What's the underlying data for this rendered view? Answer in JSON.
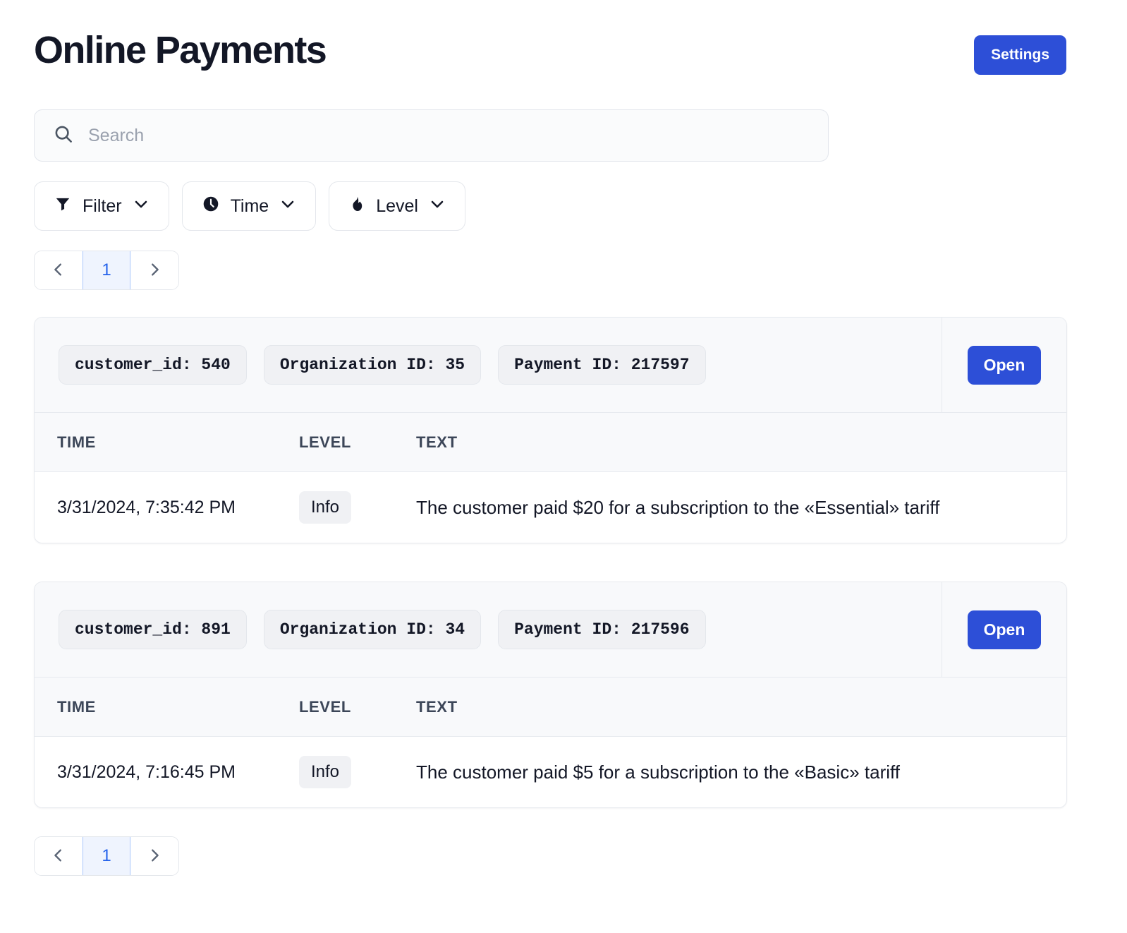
{
  "header": {
    "title": "Online Payments",
    "settings_label": "Settings"
  },
  "search": {
    "placeholder": "Search",
    "value": "",
    "icon": "search-icon"
  },
  "filters": [
    {
      "label": "Filter",
      "icon": "funnel-icon",
      "chevron": "chevron-down-icon"
    },
    {
      "label": "Time",
      "icon": "clock-icon",
      "chevron": "chevron-down-icon"
    },
    {
      "label": "Level",
      "icon": "flame-icon",
      "chevron": "chevron-down-icon"
    }
  ],
  "pagination": {
    "prev_icon": "chevron-left-icon",
    "next_icon": "chevron-right-icon",
    "current_page": "1"
  },
  "table_headers": {
    "time": "TIME",
    "level": "LEVEL",
    "text": "TEXT"
  },
  "open_label": "Open",
  "colors": {
    "accent_blue": "#2d4fd7",
    "page_link_blue": "#2563eb",
    "page_link_bg": "#eff4fe",
    "card_header_bg": "#f8f9fb",
    "tag_bg": "#f0f1f4",
    "border": "#e7eaef",
    "text_dark": "#131726",
    "placeholder_gray": "#9aa1ae"
  },
  "cards": [
    {
      "tags": [
        "customer_id: 540",
        "Organization ID: 35",
        "Payment ID: 217597"
      ],
      "open_label": "Open",
      "rows": [
        {
          "time": "3/31/2024, 7:35:42 PM",
          "level": "Info",
          "text": "The customer paid $20 for a subscription to the «Essential» tariff"
        }
      ]
    },
    {
      "tags": [
        "customer_id: 891",
        "Organization ID: 34",
        "Payment ID: 217596"
      ],
      "open_label": "Open",
      "rows": [
        {
          "time": "3/31/2024, 7:16:45 PM",
          "level": "Info",
          "text": "The customer paid $5 for a subscription to the «Basic» tariff"
        }
      ]
    }
  ]
}
